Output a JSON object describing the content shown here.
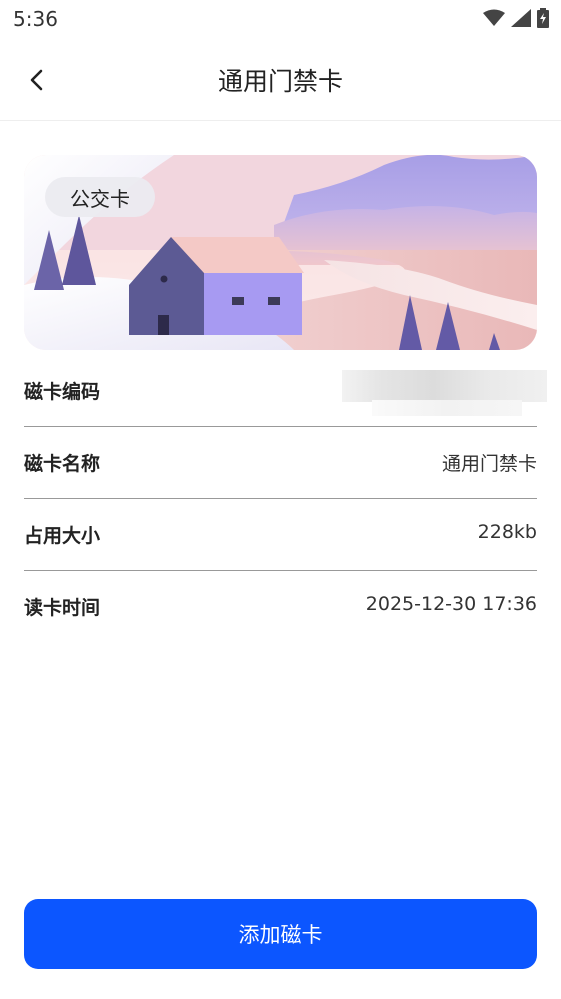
{
  "status_bar": {
    "time": "5:36"
  },
  "header": {
    "title": "通用门禁卡"
  },
  "card": {
    "tag": "公交卡"
  },
  "info": {
    "rows": [
      {
        "label": "磁卡编码",
        "value": ""
      },
      {
        "label": "磁卡名称",
        "value": "通用门禁卡"
      },
      {
        "label": "占用大小",
        "value": "228kb"
      },
      {
        "label": "读卡时间",
        "value": "2025-12-30 17:36"
      }
    ]
  },
  "actions": {
    "add_card_label": "添加磁卡"
  },
  "colors": {
    "primary_button": "#0c56ff"
  }
}
